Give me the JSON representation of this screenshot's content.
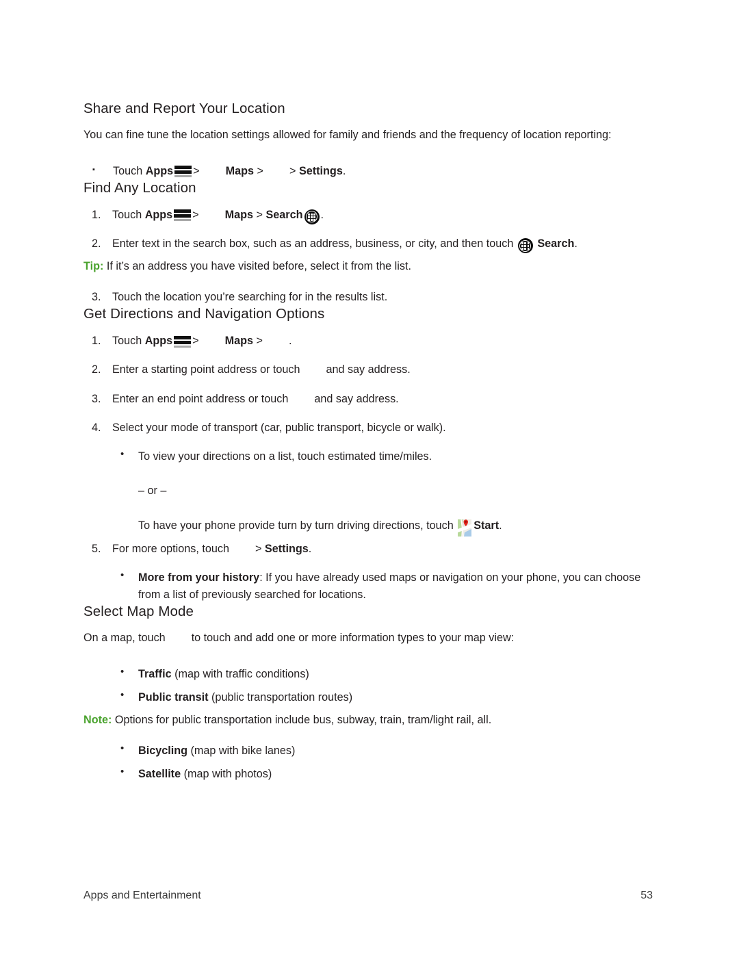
{
  "document": {
    "sections": [
      {
        "id": "share-report-location",
        "heading": "Share and Report Your Location",
        "intro": "You can fine tune the location settings allowed for family and friends and the frequency of location reporting:",
        "bullet_marker": "▪",
        "step_touch": "Touch ",
        "label_apps": "Apps",
        "sep1": ">",
        "label_maps": "Maps",
        "sep2": ">",
        "sep3": ">",
        "label_settings": "Settings",
        "period": "."
      },
      {
        "id": "find-any-location",
        "heading": "Find Any Location",
        "step1": {
          "num": "1.",
          "touch": "Touch ",
          "apps": "Apps",
          "sep1": ">",
          "maps": "Maps",
          "sep2": ">",
          "search": "Search",
          "period": "."
        },
        "step2": {
          "num": "2.",
          "text_before": "Enter text in the search box, such as an address, business, or city, and then touch ",
          "search": "Search",
          "period": "."
        },
        "tip": {
          "label": "Tip:",
          "text": " If it’s an address you have visited before, select it from the list."
        },
        "step3": {
          "num": "3.",
          "text": "Touch the location you’re searching for in the results list."
        }
      },
      {
        "id": "get-directions",
        "heading": "Get Directions and Navigation Options",
        "step1": {
          "num": "1.",
          "touch": "Touch ",
          "apps": "Apps",
          "sep1": ">",
          "maps": "Maps",
          "sep2": ">",
          "period": "."
        },
        "step2": {
          "num": "2.",
          "text_before": "Enter a starting point address or touch",
          "text_after": "and say address."
        },
        "step3": {
          "num": "3.",
          "text_before": "Enter an end point address or touch",
          "text_after": "and say address."
        },
        "step4": {
          "num": "4.",
          "text": "Select your mode of transport (car, public transport, bicycle or walk).",
          "sub1": "To view your directions on a list, touch estimated time/miles.",
          "or": "– or –",
          "sub2_before": "To have your phone provide turn by turn driving directions, touch ",
          "sub2_bold": "Start",
          "sub2_after": "."
        },
        "step5": {
          "num": "5.",
          "text_before": "For more options, touch",
          "sep": ">",
          "settings": "Settings",
          "period": "."
        },
        "step5_sub": {
          "bold": "More from your history",
          "text": ": If you have already used maps or navigation on your phone, you can choose from a list of previously searched for locations."
        }
      },
      {
        "id": "select-map-mode",
        "heading": "Select Map Mode",
        "intro_before": "On a map, touch",
        "intro_after": "to touch and add one or more information types to your map view:",
        "options": [
          {
            "bold": "Traffic",
            "text": " (map with traffic conditions)"
          },
          {
            "bold": "Public transit",
            "text": " (public transportation routes)"
          }
        ],
        "note": {
          "label": "Note:",
          "text": " Options for public transportation include bus, subway, train, tram/light rail, all."
        },
        "options2": [
          {
            "bold": "Bicycling",
            "text": " (map with bike lanes)"
          },
          {
            "bold": "Satellite",
            "text": " (map with photos)"
          }
        ]
      }
    ],
    "footer": {
      "chapter": "Apps and Entertainment",
      "page_number": "53"
    },
    "icons": {
      "apps_key": "apps-key-icon",
      "app_grid": "app-grid-icon",
      "maps_start": "maps-start-icon"
    },
    "colors": {
      "accent_green": "#4ba32f",
      "text": "#231f20"
    }
  }
}
